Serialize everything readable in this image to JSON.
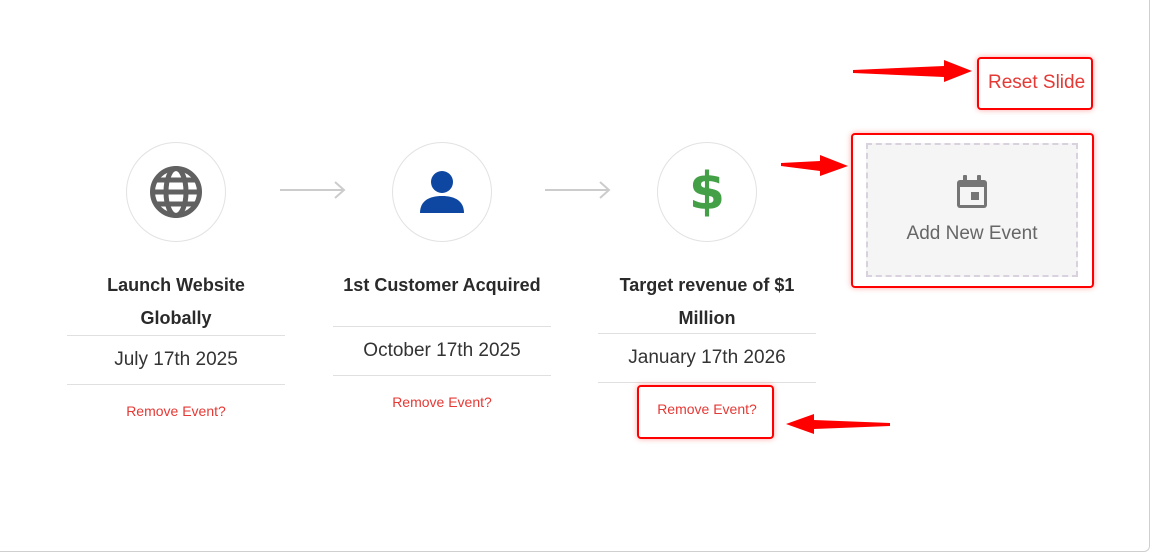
{
  "events": [
    {
      "icon": "globe-icon",
      "icon_color": "#616161",
      "title": "Launch Website Globally",
      "date": "July 17th 2025",
      "remove_label": "Remove Event?"
    },
    {
      "icon": "person-icon",
      "icon_color": "#0d47a1",
      "title": "1st Customer Acquired",
      "date": "October 17th 2025",
      "remove_label": "Remove Event?"
    },
    {
      "icon": "dollar-icon",
      "icon_color": "#43a047",
      "title": "Target revenue of $1 Million",
      "date": "January 17th 2026",
      "remove_label": "Remove Event?"
    }
  ],
  "add_event": {
    "label": "Add New Event",
    "icon": "calendar-icon"
  },
  "reset": {
    "label": "Reset Slide"
  },
  "colors": {
    "accent_red": "#e53935",
    "annotation_red": "#ff0000",
    "connector_gray": "#cccccc"
  }
}
